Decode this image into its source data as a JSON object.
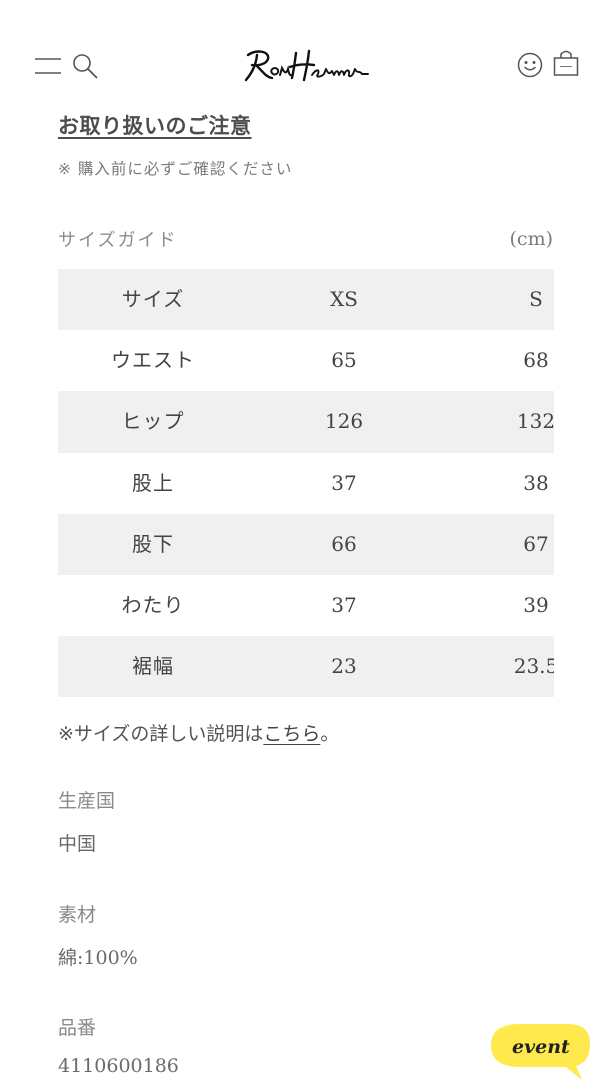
{
  "header": {
    "menu_icon": "hamburger-icon",
    "search_icon": "search-icon",
    "logo_text": "RonHerman",
    "account_icon": "smiley-icon",
    "cart_icon": "shopping-bag-icon"
  },
  "notice": {
    "title": "お取り扱いのご注意",
    "subtitle": "※ 購入前に必ずご確認ください"
  },
  "size_guide": {
    "title": "サイズガイド",
    "unit": "(cm)",
    "header": {
      "label": "サイズ",
      "xs": "XS",
      "s": "S"
    },
    "rows": [
      {
        "label": "ウエスト",
        "xs": "65",
        "s": "68"
      },
      {
        "label": "ヒップ",
        "xs": "126",
        "s": "132"
      },
      {
        "label": "股上",
        "xs": "37",
        "s": "38"
      },
      {
        "label": "股下",
        "xs": "66",
        "s": "67"
      },
      {
        "label": "わたり",
        "xs": "37",
        "s": "39"
      },
      {
        "label": "裾幅",
        "xs": "23",
        "s": "23.5"
      }
    ],
    "note_prefix": "※サイズの詳しい説明は",
    "note_link": "こちら",
    "note_suffix": "。"
  },
  "specs": {
    "origin_label": "生産国",
    "origin_value": "中国",
    "material_label": "素材",
    "material_value": "綿:100%",
    "product_number_label": "品番",
    "product_number_value": "4110600186"
  },
  "event_badge": {
    "label": "event",
    "color": "#ffe94d"
  }
}
